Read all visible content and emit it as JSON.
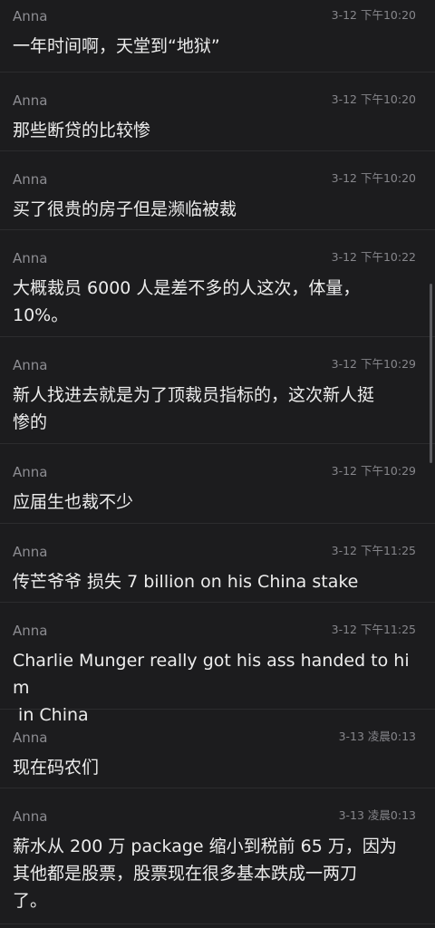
{
  "messages": [
    {
      "sender": "Anna",
      "time": "3-12 下午10:20",
      "text": "一年时间啊，天堂到“地狱”"
    },
    {
      "sender": "Anna",
      "time": "3-12 下午10:20",
      "text": "那些断贷的比较惨"
    },
    {
      "sender": "Anna",
      "time": "3-12 下午10:20",
      "text": "买了很贵的房子但是濒临被裁"
    },
    {
      "sender": "Anna",
      "time": "3-12 下午10:22",
      "text": "大概裁员 6000 人是差不多的人这次，体量，\n10%。"
    },
    {
      "sender": "Anna",
      "time": "3-12 下午10:29",
      "text": "新人找进去就是为了顶裁员指标的，这次新人挺\n惨的"
    },
    {
      "sender": "Anna",
      "time": "3-12 下午10:29",
      "text": "应届生也裁不少"
    },
    {
      "sender": "Anna",
      "time": "3-12 下午11:25",
      "text": "传芒爷爷 损失 7 billion on his China stake"
    },
    {
      "sender": "Anna",
      "time": "3-12 下午11:25",
      "text": "Charlie Munger really got his ass handed to him\n in China"
    },
    {
      "sender": "Anna",
      "time": "3-13 凌晨0:13",
      "text": "现在码农们"
    },
    {
      "sender": "Anna",
      "time": "3-13 凌晨0:13",
      "text": "薪水从 200 万 package 缩小到税前 65 万，因为\n其他都是股票，股票现在很多基本跌成一两刀\n了。"
    }
  ]
}
